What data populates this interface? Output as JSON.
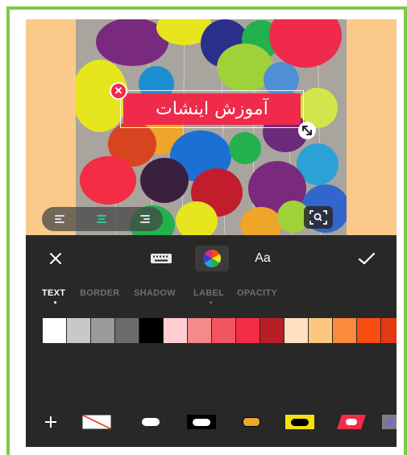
{
  "sticker": {
    "text": "آموزش اینشات",
    "color": "#ef2a4a"
  },
  "toolbar": {
    "font_label": "Aa"
  },
  "tabs": [
    {
      "label": "TEXT",
      "active": true
    },
    {
      "label": "BORDER",
      "active": false
    },
    {
      "label": "SHADOW",
      "active": false
    },
    {
      "label": "LABEL",
      "active": false
    },
    {
      "label": "OPACITY",
      "active": false
    }
  ],
  "palette": {
    "colors": [
      "#ffffff",
      "#c8c8c8",
      "#9b9b9b",
      "#6b6b6b",
      "#000000",
      "#ffcdd2",
      "#f58a8a",
      "#f2555f",
      "#f42c45",
      "#b81e24",
      "#ffe0c0",
      "#fcc77e",
      "#fb8a3a",
      "#f94d12",
      "#e33a14"
    ]
  },
  "label_styles": [
    "none",
    "white-pill",
    "black-white-pill",
    "orange-pill",
    "yellow-black-pill",
    "red-slant",
    "purple-partial"
  ],
  "colors": {
    "accent": "#2ec4a0",
    "frame": "#7ec84a",
    "panel": "#282828",
    "canvas_bg": "#fbc98a",
    "tab_inactive": "#6f6f6f"
  },
  "icons": {
    "close": "close-icon",
    "keyboard": "keyboard-icon",
    "color": "color-wheel-icon",
    "confirm": "checkmark-icon",
    "add": "plus-icon",
    "zoom": "zoom-focus-icon",
    "resize": "resize-icon",
    "remove": "remove-sticker-icon"
  }
}
